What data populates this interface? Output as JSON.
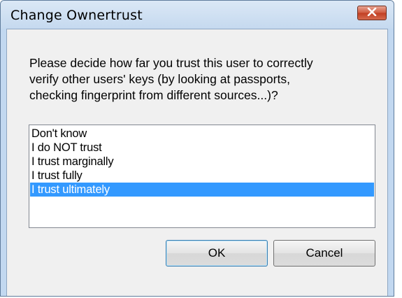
{
  "window": {
    "title": "Change Ownertrust",
    "close_icon": "close-icon"
  },
  "prompt": {
    "lines": [
      "Please decide how far you trust this user to correctly",
      "verify other users' keys (by looking at passports,",
      "checking fingerprint from different sources...)?"
    ]
  },
  "trust_list": {
    "items": [
      "Don't know",
      "I do NOT trust",
      "I trust marginally",
      "I trust fully",
      "I trust ultimately"
    ],
    "selected": "I trust ultimately"
  },
  "buttons": {
    "ok_label": "OK",
    "cancel_label": "Cancel"
  },
  "colors": {
    "selection": "#3399ff",
    "close_button": "#c13e22",
    "frame": "#c2d8f0"
  }
}
